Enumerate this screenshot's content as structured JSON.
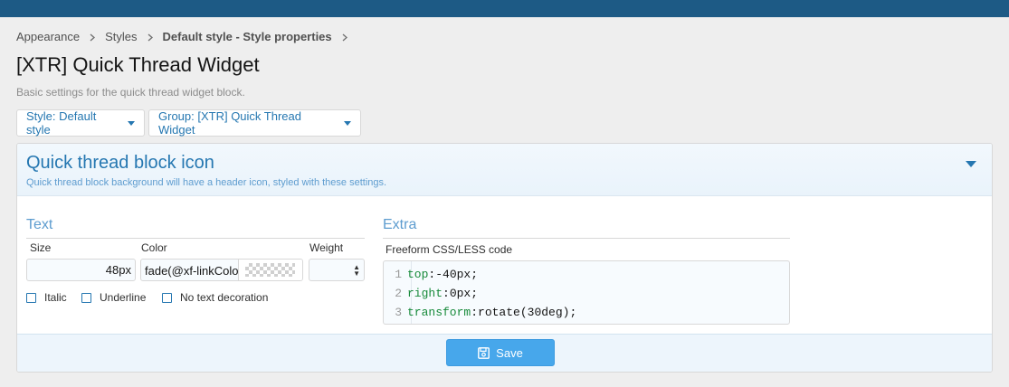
{
  "breadcrumb": [
    {
      "label": "Appearance",
      "bold": false
    },
    {
      "label": "Styles",
      "bold": false
    },
    {
      "label": "Default style - Style properties",
      "bold": true
    }
  ],
  "page": {
    "title": "[XTR] Quick Thread Widget",
    "description": "Basic settings for the quick thread widget block."
  },
  "filters": {
    "style_label": "Style: Default style",
    "group_label": "Group: [XTR] Quick Thread Widget"
  },
  "panel": {
    "title": "Quick thread block icon",
    "subtitle": "Quick thread block background will have a header icon, styled with these settings."
  },
  "text_group": {
    "title": "Text",
    "size_label": "Size",
    "size_value": "48px",
    "color_label": "Color",
    "color_value": "fade(@xf-linkColo",
    "weight_label": "Weight",
    "checkboxes": [
      "Italic",
      "Underline",
      "No text decoration"
    ]
  },
  "extra_group": {
    "title": "Extra",
    "code_label": "Freeform CSS/LESS code",
    "code_lines": [
      {
        "num": "1",
        "prop": "top",
        "value": " -40px;"
      },
      {
        "num": "2",
        "prop": "right",
        "value": " 0px;"
      },
      {
        "num": "3",
        "prop": "transform",
        "value": " rotate(30deg);"
      }
    ]
  },
  "actions": {
    "save_label": "Save"
  },
  "colors": {
    "topbar": "#1d5a85",
    "accent": "#2577b1",
    "save_button": "#47a7eb",
    "code_property": "#178a3a"
  },
  "icons": {
    "breadcrumb_separator": "chevron-right-icon",
    "collapse": "caret-down-icon",
    "save": "floppy-disk-icon"
  }
}
